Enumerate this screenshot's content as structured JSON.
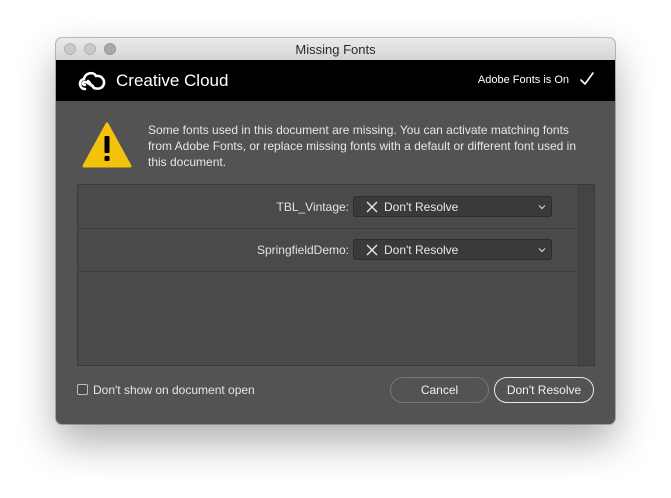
{
  "window": {
    "title": "Missing Fonts"
  },
  "header": {
    "brand": "Creative Cloud",
    "status": "Adobe Fonts is On"
  },
  "message": "Some fonts used in this document are missing. You can activate matching fonts from Adobe Fonts, or replace missing fonts with a default or different font used in this document.",
  "fonts": [
    {
      "name": "TBL_Vintage:",
      "action": "Don't Resolve"
    },
    {
      "name": "SpringfieldDemo:",
      "action": "Don't Resolve"
    }
  ],
  "footer": {
    "checkbox_label": "Don't show on document open",
    "checkbox_checked": false,
    "cancel_label": "Cancel",
    "resolve_label": "Don't Resolve"
  },
  "colors": {
    "panel": "#535353",
    "header": "#000000",
    "warning": "#f3c20d"
  }
}
